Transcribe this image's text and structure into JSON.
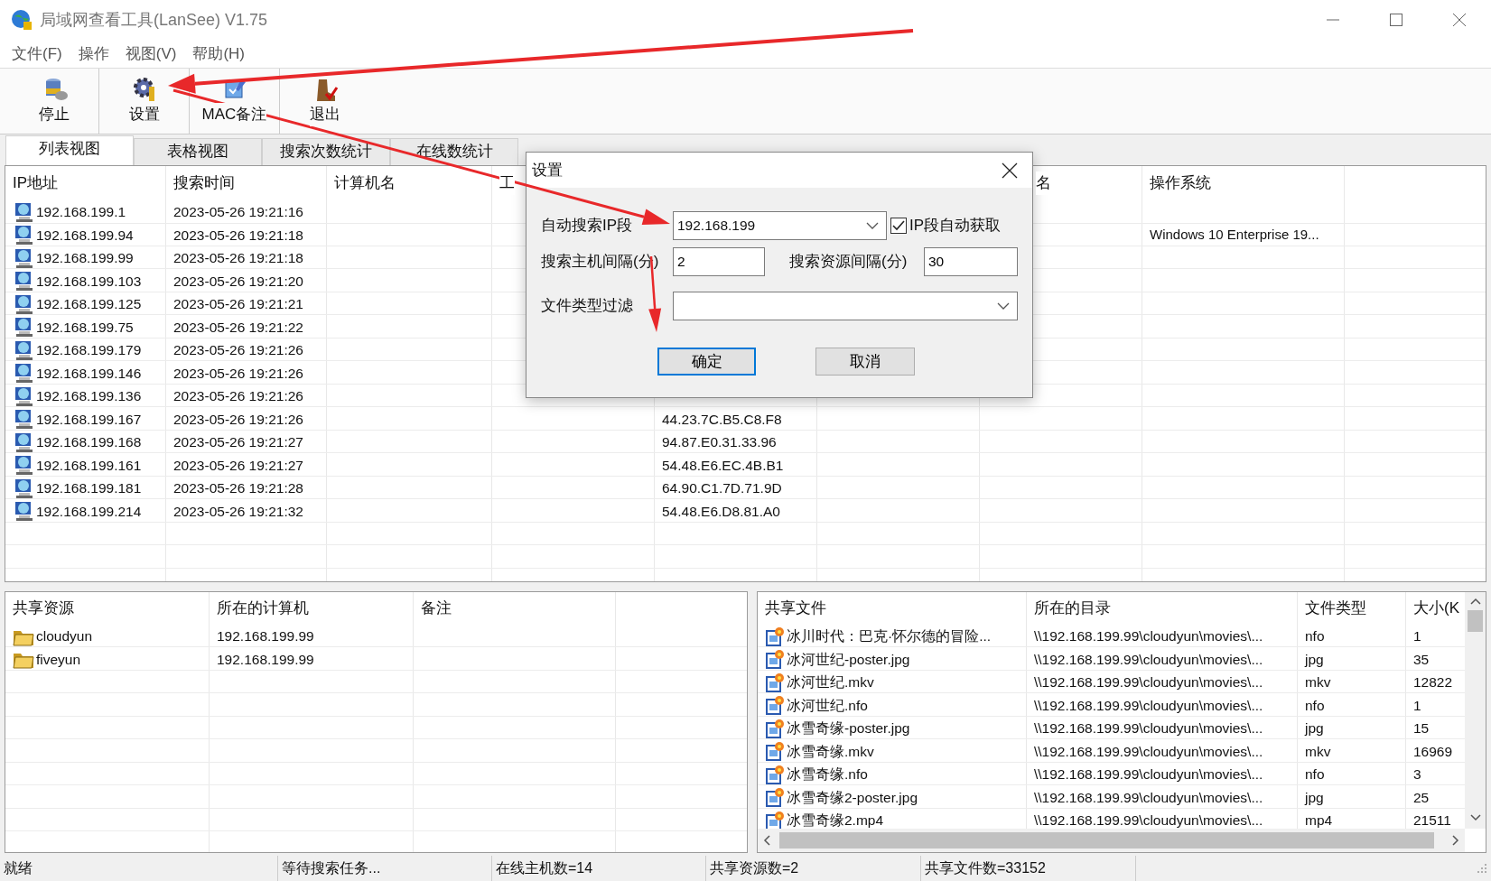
{
  "window": {
    "title": "局域网查看工具(LanSee) V1.75"
  },
  "menu": [
    "文件(F)",
    "操作",
    "视图(V)",
    "帮助(H)"
  ],
  "toolbar": [
    {
      "label": "停止",
      "kind": "stop"
    },
    {
      "label": "设置",
      "kind": "settings"
    },
    {
      "label": "MAC备注",
      "kind": "note"
    },
    {
      "label": "退出",
      "kind": "exit"
    }
  ],
  "tabs": [
    {
      "label": "列表视图",
      "selected": true
    },
    {
      "label": "表格视图",
      "selected": false
    },
    {
      "label": "搜索次数统计",
      "selected": false
    },
    {
      "label": "在线数统计",
      "selected": false
    }
  ],
  "hosts": {
    "columns": [
      {
        "header": "IP地址"
      },
      {
        "header": "搜索时间"
      },
      {
        "header": "计算机名"
      },
      {
        "header": "工"
      },
      {},
      {},
      {
        "header": "名"
      },
      {
        "header": "操作系统"
      }
    ],
    "rows": [
      {
        "ip": "192.168.199.1",
        "time": "2023-05-26 19:21:16"
      },
      {
        "ip": "192.168.199.94",
        "time": "2023-05-26 19:21:18",
        "os": "Windows 10 Enterprise 19..."
      },
      {
        "ip": "192.168.199.99",
        "time": "2023-05-26 19:21:18"
      },
      {
        "ip": "192.168.199.103",
        "time": "2023-05-26 19:21:20"
      },
      {
        "ip": "192.168.199.125",
        "time": "2023-05-26 19:21:21"
      },
      {
        "ip": "192.168.199.75",
        "time": "2023-05-26 19:21:22"
      },
      {
        "ip": "192.168.199.179",
        "time": "2023-05-26 19:21:26"
      },
      {
        "ip": "192.168.199.146",
        "time": "2023-05-26 19:21:26"
      },
      {
        "ip": "192.168.199.136",
        "time": "2023-05-26 19:21:26"
      },
      {
        "ip": "192.168.199.167",
        "time": "2023-05-26 19:21:26",
        "mac": "44.23.7C.B5.C8.F8"
      },
      {
        "ip": "192.168.199.168",
        "time": "2023-05-26 19:21:27",
        "mac": "94.87.E0.31.33.96"
      },
      {
        "ip": "192.168.199.161",
        "time": "2023-05-26 19:21:27",
        "mac": "54.48.E6.EC.4B.B1"
      },
      {
        "ip": "192.168.199.181",
        "time": "2023-05-26 19:21:28",
        "mac": "64.90.C1.7D.71.9D"
      },
      {
        "ip": "192.168.199.214",
        "time": "2023-05-26 19:21:32",
        "mac": "54.48.E6.D8.81.A0"
      }
    ]
  },
  "dialog": {
    "title": "设置",
    "ip_range": {
      "label": "自动搜索IP段",
      "value": "192.168.199"
    },
    "auto_ip": {
      "label": "IP段自动获取",
      "checked": true
    },
    "host_interval": {
      "label": "搜索主机间隔(分)",
      "value": "2"
    },
    "resource_interval": {
      "label": "搜索资源间隔(分)",
      "value": "30"
    },
    "file_filter": {
      "label": "文件类型过滤"
    },
    "buttons": [
      {
        "label": "确定",
        "default": true
      },
      {
        "label": "取消",
        "default": false
      }
    ]
  },
  "shares": {
    "columns": [
      "共享资源",
      "所在的计算机",
      "备注"
    ],
    "rows": [
      {
        "name": "cloudyun",
        "computer": "192.168.199.99"
      },
      {
        "name": "fiveyun",
        "computer": "192.168.199.99"
      }
    ]
  },
  "files": {
    "columns": [
      "共享文件",
      "所在的目录",
      "文件类型",
      "大小(K"
    ],
    "rows": [
      {
        "name": "冰川时代：巴克·怀尔德的冒险...",
        "dir": "\\\\192.168.199.99\\cloudyun\\movies\\...",
        "type": "nfo",
        "size": "1"
      },
      {
        "name": "冰河世纪-poster.jpg",
        "dir": "\\\\192.168.199.99\\cloudyun\\movies\\...",
        "type": "jpg",
        "size": "35"
      },
      {
        "name": "冰河世纪.mkv",
        "dir": "\\\\192.168.199.99\\cloudyun\\movies\\...",
        "type": "mkv",
        "size": "12822"
      },
      {
        "name": "冰河世纪.nfo",
        "dir": "\\\\192.168.199.99\\cloudyun\\movies\\...",
        "type": "nfo",
        "size": "1"
      },
      {
        "name": "冰雪奇缘-poster.jpg",
        "dir": "\\\\192.168.199.99\\cloudyun\\movies\\...",
        "type": "jpg",
        "size": "15"
      },
      {
        "name": "冰雪奇缘.mkv",
        "dir": "\\\\192.168.199.99\\cloudyun\\movies\\...",
        "type": "mkv",
        "size": "16969"
      },
      {
        "name": "冰雪奇缘.nfo",
        "dir": "\\\\192.168.199.99\\cloudyun\\movies\\...",
        "type": "nfo",
        "size": "3"
      },
      {
        "name": "冰雪奇缘2-poster.jpg",
        "dir": "\\\\192.168.199.99\\cloudyun\\movies\\...",
        "type": "jpg",
        "size": "25"
      },
      {
        "name": "冰雪奇缘2.mp4",
        "dir": "\\\\192.168.199.99\\cloudyun\\movies\\...",
        "type": "mp4",
        "size": "21511"
      }
    ]
  },
  "status_bar": [
    "就绪",
    "等待搜索任务...",
    "在线主机数=14",
    "共享资源数=2",
    "共享文件数=33152"
  ]
}
